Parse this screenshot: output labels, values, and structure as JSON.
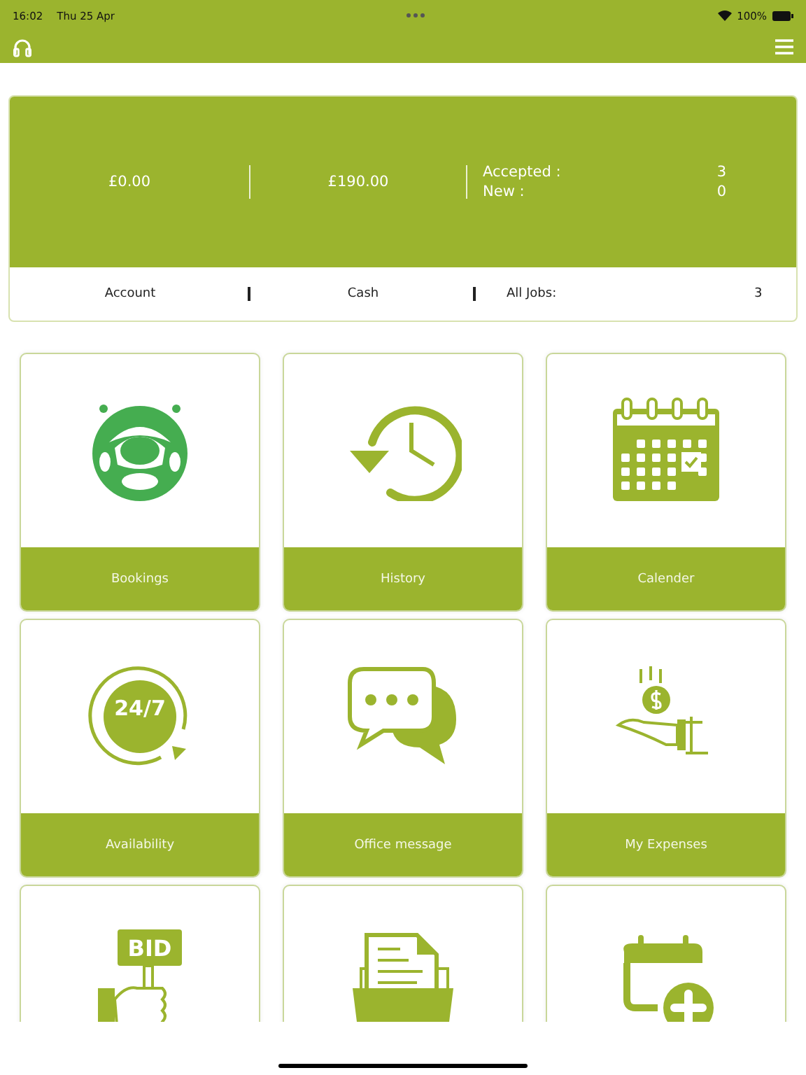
{
  "status_bar": {
    "time": "16:02",
    "date": "Thu 25 Apr",
    "battery": "100%"
  },
  "stats": {
    "account": "£0.00",
    "cash": "£190.00",
    "jobs": [
      {
        "label": "Accepted :",
        "value": "3"
      },
      {
        "label": "New :",
        "value": "0"
      }
    ]
  },
  "summary": {
    "account_label": "Account",
    "cash_label": "Cash",
    "all_jobs_label": "All Jobs:",
    "all_jobs_value": "3"
  },
  "tiles": [
    {
      "kind": "steering",
      "label": "Bookings"
    },
    {
      "kind": "history",
      "label": "History"
    },
    {
      "kind": "calendar",
      "label": "Calender"
    },
    {
      "kind": "clock",
      "icon_text": "24/7",
      "label": "Availability"
    },
    {
      "kind": "chat",
      "label": "Office message"
    },
    {
      "kind": "expenses",
      "label": "My Expenses"
    },
    {
      "kind": "bid",
      "icon_text": "BID"
    },
    {
      "kind": "documents"
    },
    {
      "kind": "planner"
    }
  ]
}
